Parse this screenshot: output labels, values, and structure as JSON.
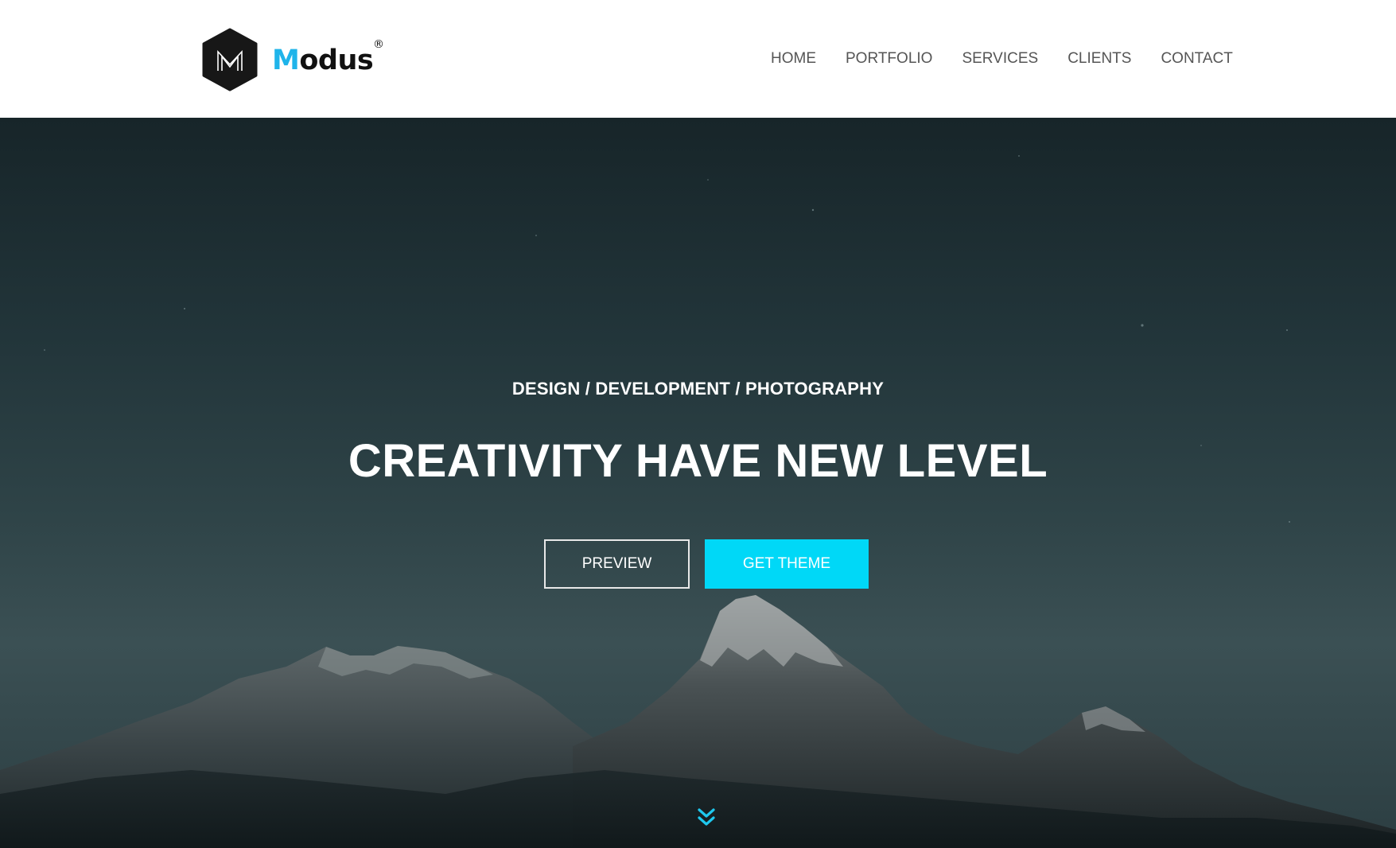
{
  "brand": {
    "name_first_letter": "M",
    "name_rest": "odus",
    "registered_mark": "®",
    "accent_color": "#1fb4ea"
  },
  "nav": {
    "items": [
      {
        "label": "HOME"
      },
      {
        "label": "PORTFOLIO"
      },
      {
        "label": "SERVICES"
      },
      {
        "label": "CLIENTS"
      },
      {
        "label": "CONTACT"
      }
    ]
  },
  "hero": {
    "tagline": "DESIGN / DEVELOPMENT / PHOTOGRAPHY",
    "headline": "CREATIVITY HAVE NEW LEVEL",
    "preview_button": "PREVIEW",
    "get_theme_button": "GET THEME",
    "button_color": "#00d8f7",
    "scroll_icon": "chevron-double-down-icon"
  }
}
